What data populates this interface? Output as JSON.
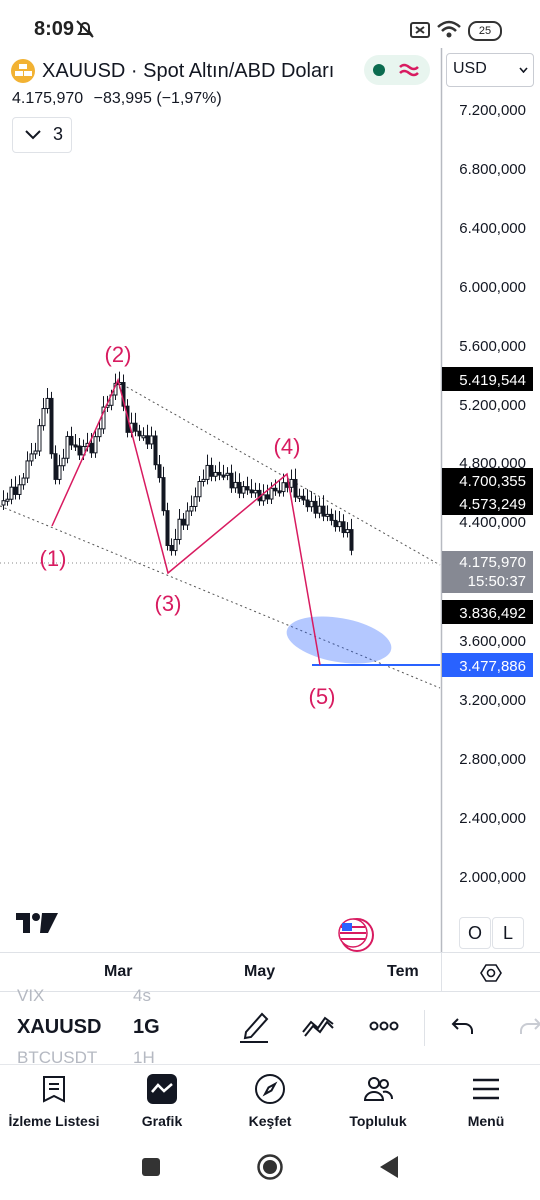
{
  "status_bar": {
    "time": "8:09",
    "battery": "25"
  },
  "header": {
    "symbol": "XAUUSD · Spot Altın/ABD Doları",
    "price": "4.175,970",
    "change": "−83,995 (−1,97%)",
    "indicator_count": "3",
    "currency": "USD"
  },
  "price_axis": {
    "ticks": [
      "7.200,000",
      "6.800,000",
      "6.400,000",
      "6.000,000",
      "5.600,000",
      "5.200,000",
      "4.800,000",
      "4.400,000",
      "3.600,000",
      "3.200,000",
      "2.800,000",
      "2.400,000",
      "2.000,000"
    ],
    "badges": {
      "b1": "5.419,544",
      "b2": "4.700,355",
      "b3": "4.573,249",
      "current": "4.175,970",
      "countdown": "15:50:37",
      "b4": "3.836,492",
      "b5": "3.477,886"
    }
  },
  "wave_labels": [
    "(1)",
    "(2)",
    "(3)",
    "(4)",
    "(5)"
  ],
  "time_axis": [
    "Mar",
    "May",
    "Tem"
  ],
  "scale_buttons": {
    "o": "O",
    "l": "L"
  },
  "toolbar": {
    "symbol": "XAUUSD",
    "interval": "1G",
    "ghost_above": "VIX",
    "ghost_above_interval": "4s",
    "ghost_below": "BTCUSDT",
    "ghost_below_interval": "1H"
  },
  "bottom_nav": [
    "İzleme Listesi",
    "Grafik",
    "Keşfet",
    "Topluluk",
    "Menü"
  ],
  "colors": {
    "accent_pink": "#d81b60",
    "zone_blue": "#2962ff",
    "candle": "#131722"
  },
  "icons": [
    "gold-coin-icon",
    "pencil-icon",
    "wave-icon",
    "more-icon",
    "undo-icon",
    "settings-icon"
  ]
}
